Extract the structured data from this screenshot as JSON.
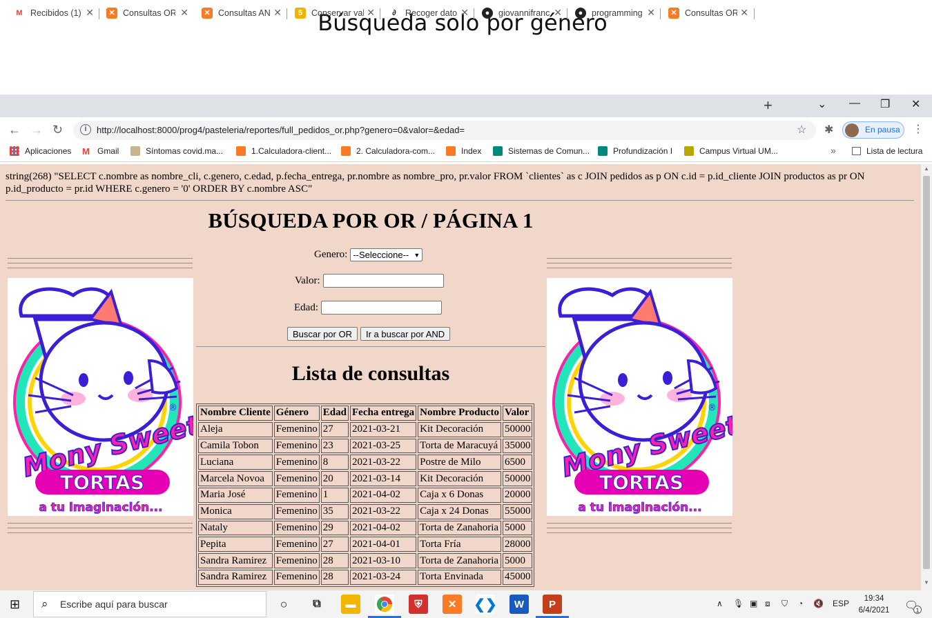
{
  "slide": {
    "title": "Búsqueda solo por género"
  },
  "browser": {
    "tabs": [
      {
        "label": "Recibidos (1) -",
        "icon": "gmail-icon"
      },
      {
        "label": "Consultas OR",
        "icon": "xampp-icon"
      },
      {
        "label": "Consultas AN",
        "icon": "xampp-icon"
      },
      {
        "label": "Conservar val",
        "icon": "html-icon"
      },
      {
        "label": "Recoger dato",
        "icon": "signature-icon"
      },
      {
        "label": "giovannifranc",
        "icon": "github-icon"
      },
      {
        "label": "programming",
        "icon": "github-icon"
      },
      {
        "label": "Consultas OR",
        "icon": "xampp-icon"
      }
    ],
    "new_tab": "+",
    "url": "http://localhost:8000/prog4/pasteleria/reportes/full_pedidos_or.php?genero=0&valor=&edad=",
    "profile_label": "En pausa",
    "bookmarks": [
      "Aplicaciones",
      "Gmail",
      "Síntomas covid.ma...",
      "1.Calculadora-client...",
      "2. Calculadora-com...",
      "Index",
      "Sistemas de Comun...",
      "Profundización I",
      "Campus Virtual UM..."
    ],
    "bookmarks_more": "»",
    "reading_list": "Lista de lectura"
  },
  "page": {
    "sql_dump": "string(268) \"SELECT c.nombre as nombre_cli, c.genero, c.edad, p.fecha_entrega, pr.nombre as nombre_pro, pr.valor FROM `clientes` as c JOIN pedidos as p ON c.id = p.id_cliente JOIN productos as pr ON p.id_producto = pr.id WHERE c.genero = '0' ORDER BY c.nombre ASC\"",
    "heading": "BÚSQUEDA POR OR / PÁGINA 1",
    "form": {
      "genero_label": "Genero:",
      "genero_selected": "--Seleccione--",
      "valor_label": "Valor:",
      "edad_label": "Edad:",
      "buscar_or_label": "Buscar por OR",
      "ir_and_label": "Ir a buscar por AND"
    },
    "list_heading": "Lista de consultas",
    "table": {
      "headers": [
        "Nombre Cliente",
        "Género",
        "Edad",
        "Fecha entrega",
        "Nombre Producto",
        "Valor"
      ],
      "rows": [
        [
          "Aleja",
          "Femenino",
          "27",
          "2021-03-21",
          "Kit Decoración",
          "50000"
        ],
        [
          "Camila Tobon",
          "Femenino",
          "23",
          "2021-03-25",
          "Torta de Maracuyá",
          "35000"
        ],
        [
          "Luciana",
          "Femenino",
          "8",
          "2021-03-22",
          "Postre de Milo",
          "6500"
        ],
        [
          "Marcela Novoa",
          "Femenino",
          "20",
          "2021-03-14",
          "Kit Decoración",
          "50000"
        ],
        [
          "Maria José",
          "Femenino",
          "1",
          "2021-04-02",
          "Caja x 6 Donas",
          "20000"
        ],
        [
          "Monica",
          "Femenino",
          "35",
          "2021-03-22",
          "Caja x 24 Donas",
          "55000"
        ],
        [
          "Nataly",
          "Femenino",
          "29",
          "2021-04-02",
          "Torta de Zanahoria",
          "5000"
        ],
        [
          "Pepita",
          "Femenino",
          "27",
          "2021-04-01",
          "Torta Fría",
          "28000"
        ],
        [
          "Sandra Ramirez",
          "Femenino",
          "28",
          "2021-03-10",
          "Torta de Zanahoria",
          "5000"
        ],
        [
          "Sandra Ramirez",
          "Femenino",
          "28",
          "2021-03-24",
          "Torta Envinada",
          "45000"
        ]
      ]
    },
    "logo": {
      "brand": "Mony Sweet",
      "sub": "TORTAS",
      "tagline": "a tu imaginación...",
      "reg": "®"
    }
  },
  "taskbar": {
    "search_placeholder": "Escribe aquí para buscar",
    "language": "ESP",
    "time": "19:34",
    "date": "6/4/2021",
    "notification_count": "1"
  },
  "colors": {
    "page_bg": "#f0d7c9",
    "brand_magenta": "#ff1fa8",
    "brand_purple": "#3a1fd6",
    "ring_teal": "#23e6b8"
  }
}
